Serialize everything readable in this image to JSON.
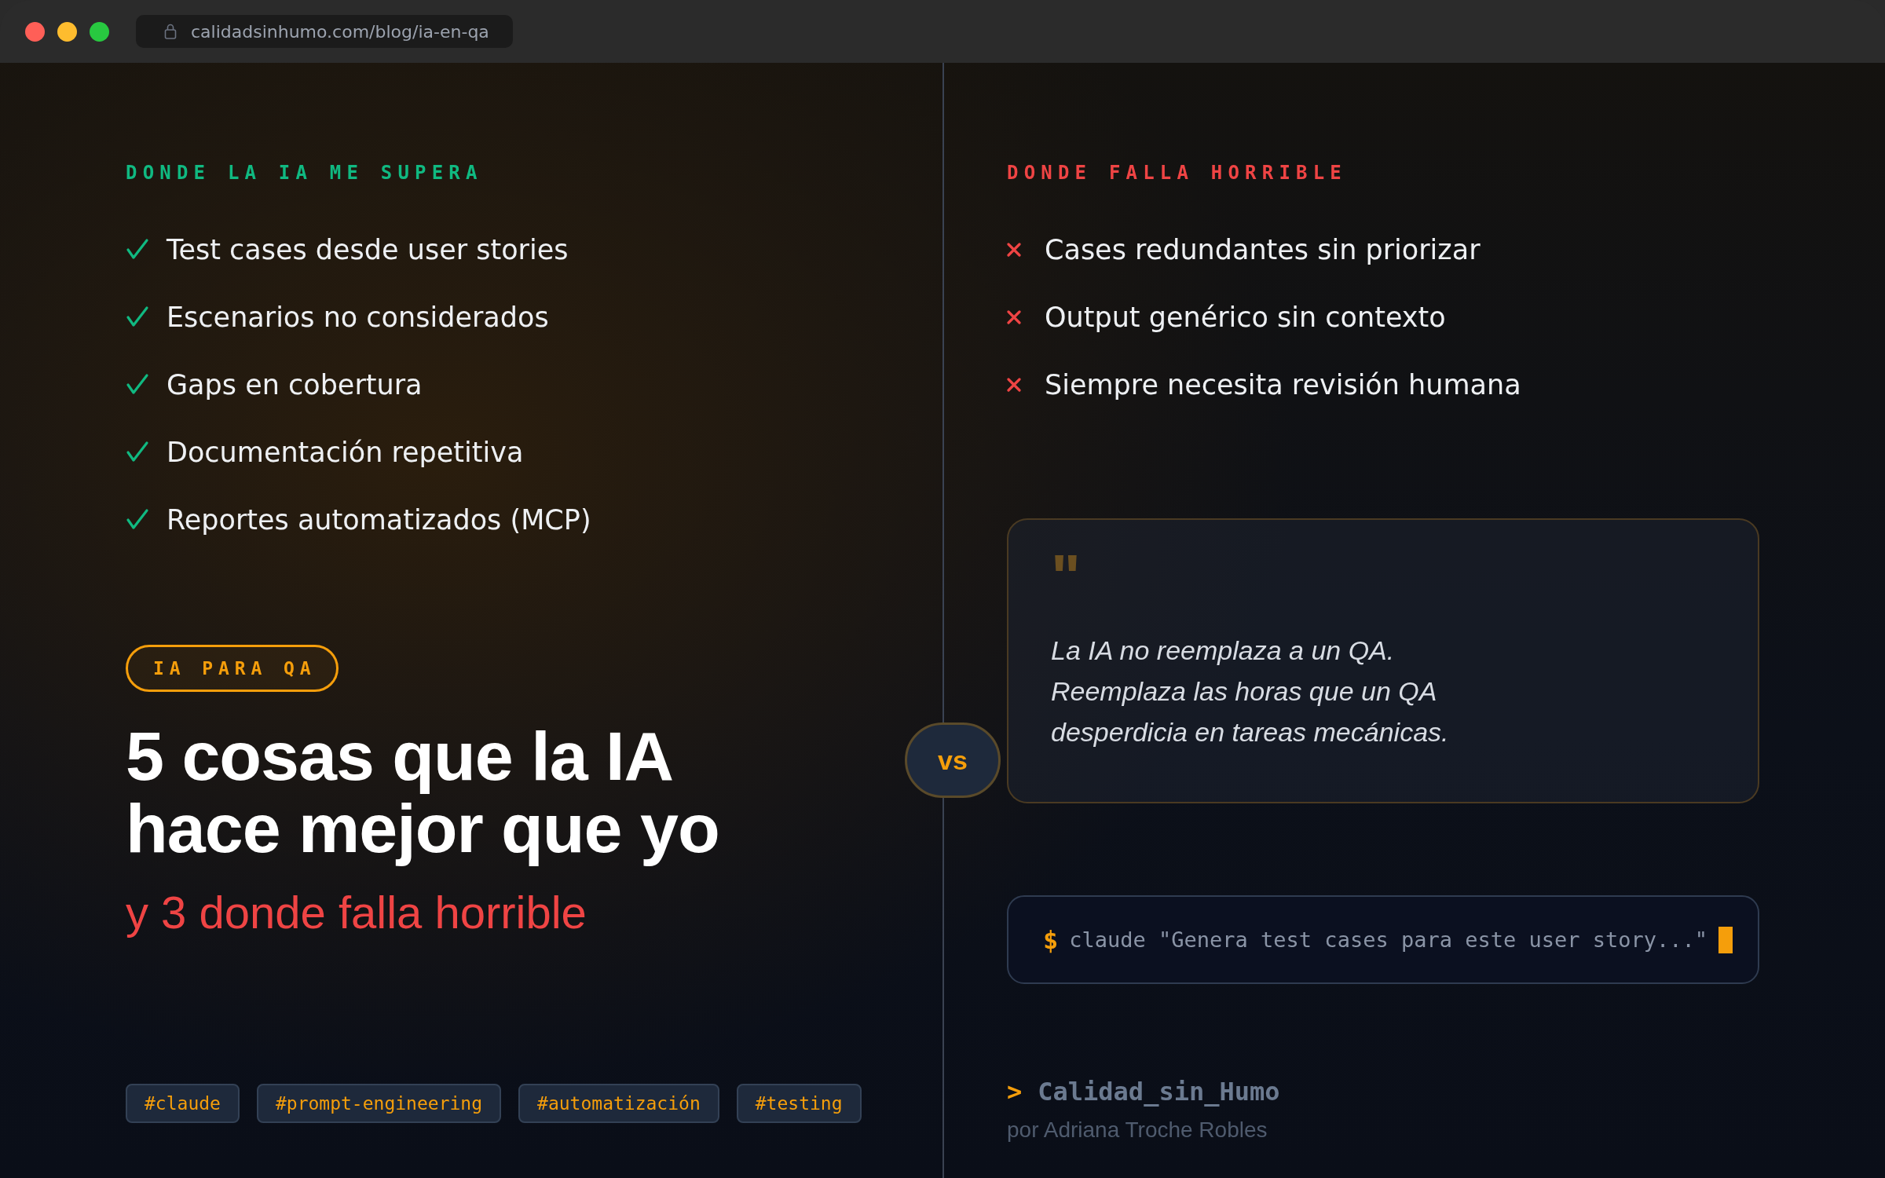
{
  "browser": {
    "url": "calidadsinhumo.com/blog/ia-en-qa"
  },
  "strengths": {
    "heading": "DONDE LA IA ME SUPERA",
    "items": [
      "Test cases desde user stories",
      "Escenarios no considerados",
      "Gaps en cobertura",
      "Documentación repetitiva",
      "Reportes automatizados (MCP)"
    ]
  },
  "weaknesses": {
    "heading": "DONDE FALLA HORRIBLE",
    "items": [
      "Cases redundantes sin priorizar",
      "Output genérico sin contexto",
      "Siempre necesita revisión humana"
    ]
  },
  "badge": "IA PARA QA",
  "headline": "5 cosas que la IA hace mejor que yo",
  "subtitle": "y 3 donde falla horrible",
  "tags": [
    "#claude",
    "#prompt-engineering",
    "#automatización",
    "#testing"
  ],
  "vs": "vs",
  "quote": {
    "mark": "\"",
    "text": "La IA no reemplaza a un QA.\nReemplaza las horas que un QA\ndesperdicia en tareas mecánicas."
  },
  "terminal": {
    "prompt": "$",
    "command": "claude \"Genera test cases para este user story...\""
  },
  "footer": {
    "prompt": ">",
    "brand": "Calidad_sin_Humo",
    "author": "por Adriana Troche Robles"
  }
}
